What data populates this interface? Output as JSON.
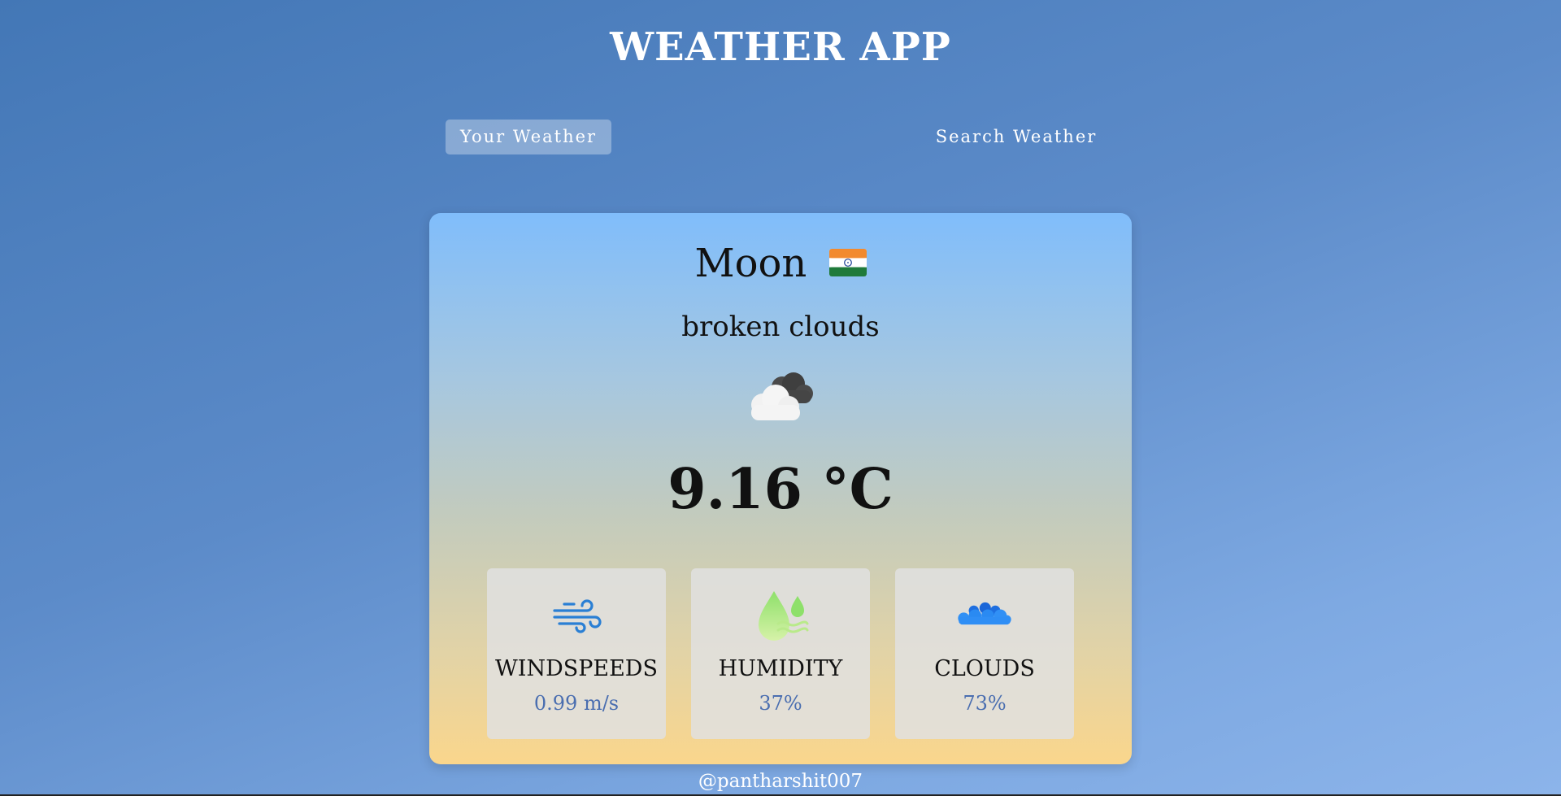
{
  "app": {
    "title": "WEATHER APP"
  },
  "tabs": [
    {
      "label": "Your Weather",
      "active": true
    },
    {
      "label": "Search Weather",
      "active": false
    }
  ],
  "weather": {
    "city": "Moon",
    "flag_icon": "india-flag-icon",
    "description": "broken clouds",
    "condition_icon": "broken-clouds-icon",
    "temperature": "9.16 °C"
  },
  "stats": [
    {
      "icon": "wind-icon",
      "label": "WINDSPEEDS",
      "value": "0.99 m/s"
    },
    {
      "icon": "humidity-icon",
      "label": "HUMIDITY",
      "value": "37%"
    },
    {
      "icon": "clouds-icon",
      "label": "CLOUDS",
      "value": "73%"
    }
  ],
  "footer": {
    "handle": "@pantharshit007"
  },
  "colors": {
    "background_top": "#4377b6",
    "background_bottom": "#8cb4ea",
    "card_top": "#80bdfb",
    "card_bottom": "#fad68c",
    "stat_value": "#4a6eb0"
  }
}
